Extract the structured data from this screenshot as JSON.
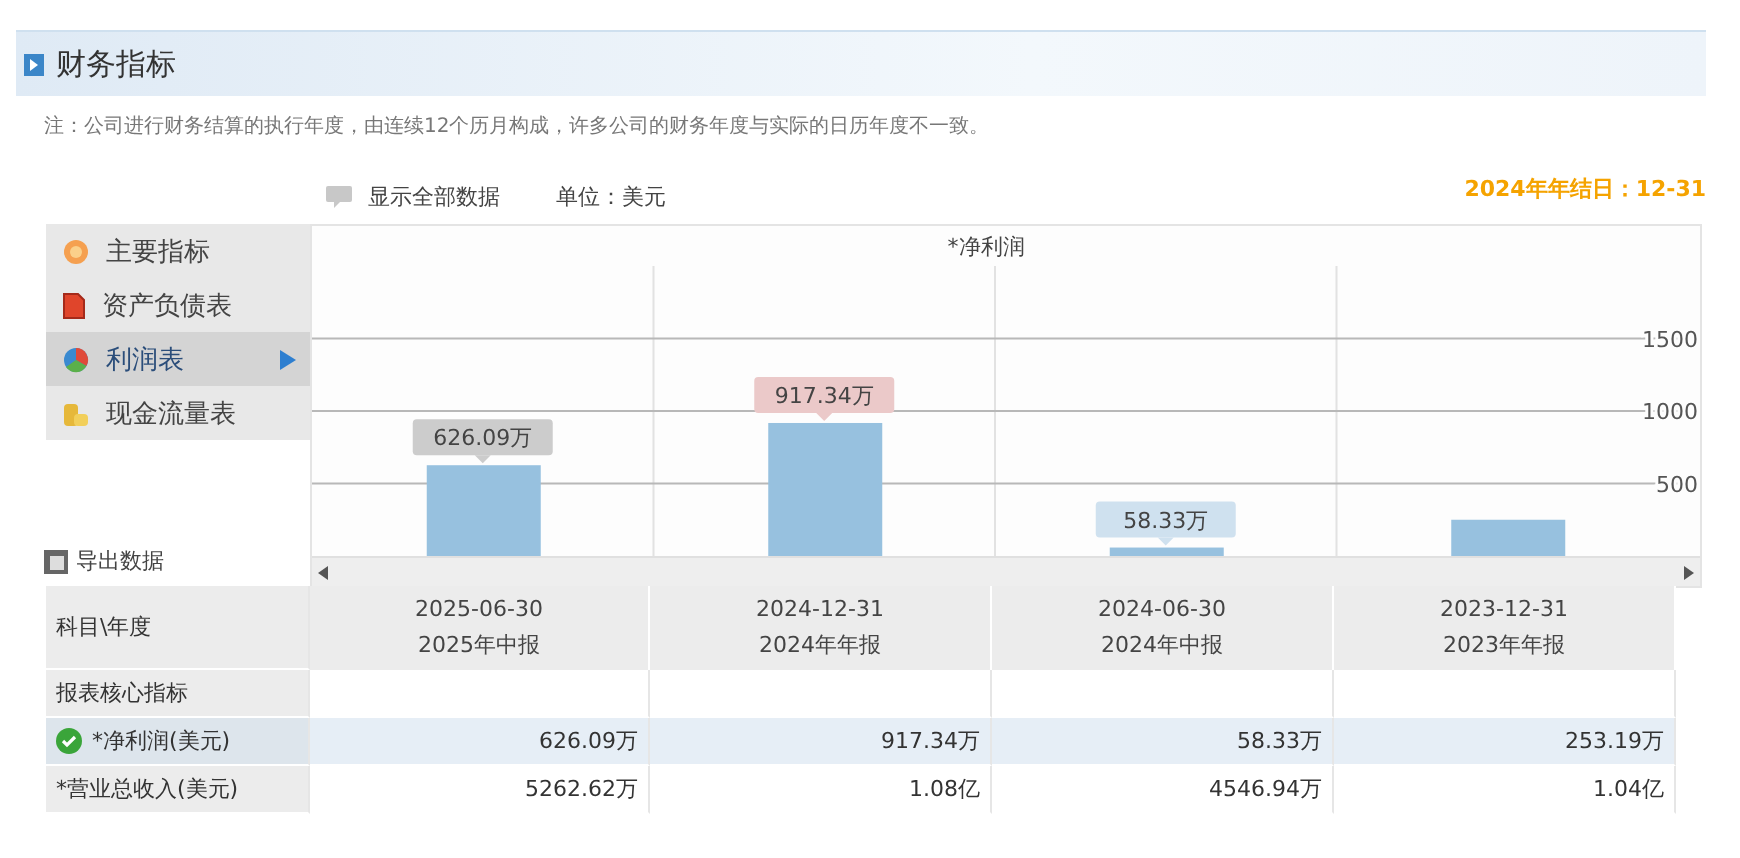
{
  "header": {
    "title": "财务指标"
  },
  "note": "注：公司进行财务结算的执行年度，由连续12个历月构成，许多公司的财务年度与实际的日历年度不一致。",
  "toolbar": {
    "show_all": "显示全部数据",
    "unit": "单位：美元",
    "fiscal_year_end": "2024年年结日：12-31"
  },
  "sidebar": {
    "items": [
      {
        "label": "主要指标",
        "selected": false
      },
      {
        "label": "资产负债表",
        "selected": false
      },
      {
        "label": "利润表",
        "selected": true
      },
      {
        "label": "现金流量表",
        "selected": false
      }
    ],
    "export": "导出数据"
  },
  "chart": {
    "value_label_styles": [
      {
        "color": "#cccccc"
      },
      {
        "color": "#ebc9c9"
      },
      {
        "color": "#cfe1ef"
      }
    ],
    "chart_data": {
      "type": "bar",
      "title": "*净利润",
      "values": [
        626.09,
        917.34,
        58.33,
        250
      ],
      "ylim": [
        0,
        2000
      ],
      "yticks": [
        500,
        1000,
        1500
      ],
      "grid": true,
      "value_labels": [
        "626.09万",
        "917.34万",
        "58.33万",
        null
      ]
    }
  },
  "table": {
    "corner": "科目\\年度",
    "columns": [
      {
        "date": "2025-06-30",
        "report": "2025年中报"
      },
      {
        "date": "2024-12-31",
        "report": "2024年年报"
      },
      {
        "date": "2024-06-30",
        "report": "2024年中报"
      },
      {
        "date": "2023-12-31",
        "report": "2023年年报"
      }
    ],
    "rows": [
      {
        "kind": "section",
        "label": "报表核心指标",
        "selected": false,
        "cells": []
      },
      {
        "kind": "data",
        "label": "*净利润(美元)",
        "selected": true,
        "cells": [
          "626.09万",
          "917.34万",
          "58.33万",
          "253.19万"
        ]
      },
      {
        "kind": "data",
        "label": "*营业总收入(美元)",
        "selected": false,
        "cells": [
          "5262.62万",
          "1.08亿",
          "4546.94万",
          "1.04亿"
        ]
      }
    ]
  }
}
